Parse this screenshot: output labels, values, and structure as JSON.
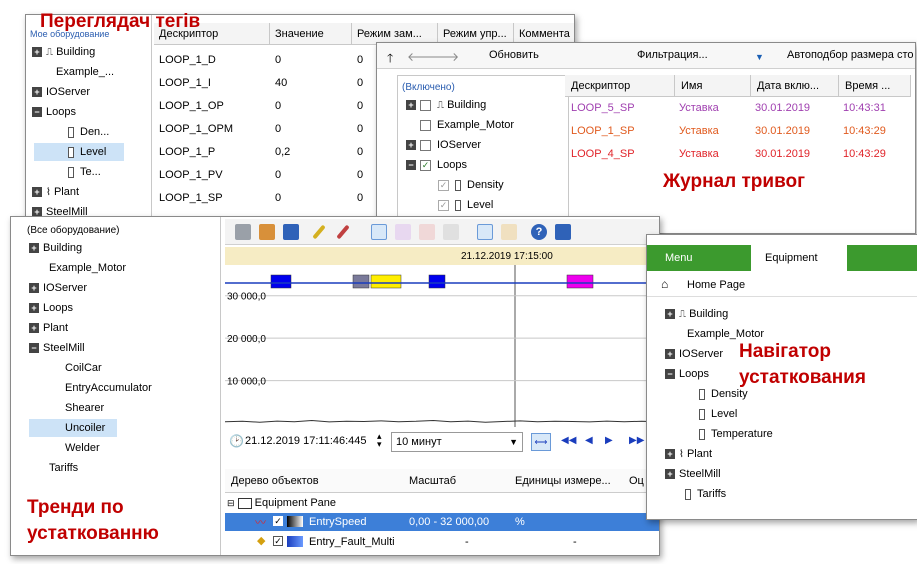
{
  "captions": {
    "tag_viewer": "Переглядач тегів",
    "alarm_journal": "Журнал тривог",
    "equipment_navigator": "Навігатор устаткования",
    "trends": "Тренди по устаткованню"
  },
  "tag_viewer": {
    "tree_caption": "Мое оборудование",
    "tree": [
      "Building",
      "Example_...",
      "IOServer",
      "Loops",
      "Den...",
      "Level",
      "Te...",
      "Plant",
      "SteelMill"
    ],
    "columns": [
      "Дескриптор",
      "Значение",
      "Режим зам...",
      "Режим упр...",
      "Коммента"
    ],
    "rows": [
      {
        "descriptor": "LOOP_1_D",
        "value": "0",
        "mode": "0"
      },
      {
        "descriptor": "LOOP_1_I",
        "value": "40",
        "mode": "0"
      },
      {
        "descriptor": "LOOP_1_OP",
        "value": "0",
        "mode": "0"
      },
      {
        "descriptor": "LOOP_1_OPM",
        "value": "0",
        "mode": "0"
      },
      {
        "descriptor": "LOOP_1_P",
        "value": "0,2",
        "mode": "0"
      },
      {
        "descriptor": "LOOP_1_PV",
        "value": "0",
        "mode": "0"
      },
      {
        "descriptor": "LOOP_1_SP",
        "value": "0",
        "mode": "0"
      }
    ]
  },
  "alarm_journal": {
    "toolbar": {
      "refresh": "Обновить",
      "filter": "Фильтрация...",
      "autosize": "Автоподбор размера сто"
    },
    "tree_caption": "(Включено)",
    "tree": [
      "Building",
      "Example_Motor",
      "IOServer",
      "Loops",
      "Density",
      "Level"
    ],
    "columns": [
      "Дескриптор",
      "Имя",
      "Дата вклю...",
      "Время ..."
    ],
    "rows": [
      {
        "descriptor": "LOOP_5_SP",
        "name": "Уставка",
        "date": "30.01.2019",
        "time": "10:43:31",
        "color": "#a040b0"
      },
      {
        "descriptor": "LOOP_1_SP",
        "name": "Уставка",
        "date": "30.01.2019",
        "time": "10:43:29",
        "color": "#e05a1e"
      },
      {
        "descriptor": "LOOP_4_SP",
        "name": "Уставка",
        "date": "30.01.2019",
        "time": "10:43:29",
        "color": "#e0242a"
      }
    ]
  },
  "trends": {
    "tree_caption": "(Все оборудование)",
    "tree": [
      "Building",
      "Example_Motor",
      "IOServer",
      "Loops",
      "Plant",
      "SteelMill",
      "CoilCar",
      "EntryAccumulator",
      "Shearer",
      "Uncoiler",
      "Welder",
      "Tariffs"
    ],
    "chart_time": "21.12.2019 17:15:00",
    "y_ticks": [
      "30 000,0",
      "20 000,0",
      "10 000,0"
    ],
    "start_time": "21.12.2019 17:11:46:445",
    "duration": "10 минут",
    "table_columns": [
      "Дерево объектов",
      "Масштаб",
      "Единицы измере...",
      "Оц"
    ],
    "group": "Equipment Pane",
    "table_rows": [
      {
        "name": "EntrySpeed",
        "scale": "0,00 - 32 000,00",
        "units": "%"
      },
      {
        "name": "Entry_Fault_Multi",
        "scale": "-",
        "units": "-"
      }
    ],
    "chart_data": {
      "type": "line",
      "title": "",
      "xlabel": "",
      "ylabel": "",
      "ylim": [
        0,
        33000
      ],
      "series": [
        {
          "values": [
            300,
            400,
            200,
            450,
            300,
            600,
            250,
            400,
            350,
            500,
            300,
            400,
            600,
            300,
            450,
            200,
            350,
            500,
            300,
            400,
            350,
            250,
            450,
            300,
            400,
            300
          ]
        }
      ],
      "event_bar_colors": [
        "#0000ee",
        "#7a7a9a",
        "#ffee00",
        "#0000ee",
        "#ee00ee"
      ]
    }
  },
  "equipment_navigator": {
    "tabs": [
      "Menu",
      "Equipment"
    ],
    "home": "Home Page",
    "tree": [
      "Building",
      "Example_Motor",
      "IOServer",
      "Loops",
      "Density",
      "Level",
      "Temperature",
      "Plant",
      "SteelMill",
      "Tariffs"
    ]
  }
}
